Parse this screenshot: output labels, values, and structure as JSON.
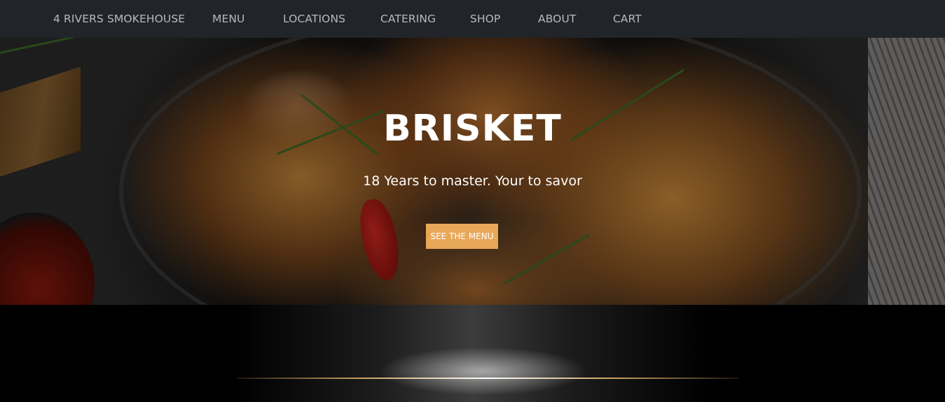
{
  "nav": {
    "brand": "4 RIVERS SMOKEHOUSE",
    "items": [
      {
        "label": "MENU"
      },
      {
        "label": "LOCATIONS"
      },
      {
        "label": "CATERING"
      },
      {
        "label": "SHOP"
      },
      {
        "label": "ABOUT"
      },
      {
        "label": "CART"
      }
    ]
  },
  "hero": {
    "title": "BRISKET",
    "subtitle": "18 Years to master. Your to savor",
    "button_label": "SEE THE MENU"
  },
  "colors": {
    "navbar_bg": "#212529",
    "nav_text": "#b7b9bc",
    "accent_button": "#e8a85a"
  }
}
